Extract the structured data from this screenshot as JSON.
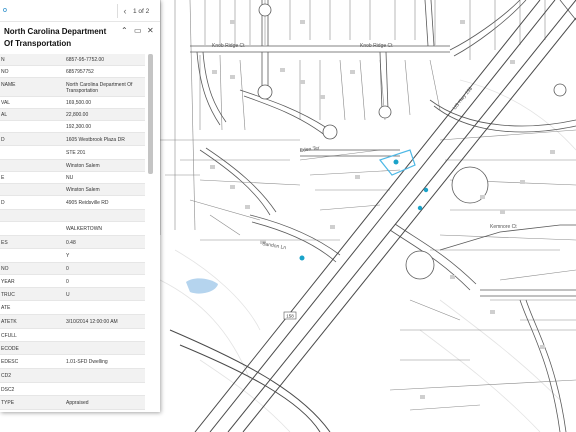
{
  "pager": {
    "zoom_label": "o",
    "count": "1 of 2"
  },
  "popup": {
    "title": "North Carolina Department Of Transportation",
    "rows": [
      {
        "key": "N",
        "value": "6857-95-7752.00"
      },
      {
        "key": "NO",
        "value": "6857957752"
      },
      {
        "key": "NAME",
        "value": "North Carolina Department Of Transportation"
      },
      {
        "key": "VAL",
        "value": "169,500.00"
      },
      {
        "key": "AL",
        "value": "22,800.00"
      },
      {
        "key": "",
        "value": "192,300.00"
      },
      {
        "key": "D",
        "value": "1605 Westbrook Plaza DR"
      },
      {
        "key": "",
        "value": "STE 201"
      },
      {
        "key": "",
        "value": "Winston Salem"
      },
      {
        "key": "E",
        "value": "NU"
      },
      {
        "key": "",
        "value": "Winston Salem"
      },
      {
        "key": "D",
        "value": "4905 Reidsville RD"
      },
      {
        "key": "",
        "value": ""
      },
      {
        "key": "",
        "value": "WALKERTOWN"
      },
      {
        "key": "ES",
        "value": "0.48"
      },
      {
        "key": "",
        "value": "Y"
      },
      {
        "key": "NO",
        "value": "0"
      },
      {
        "key": "YEAR",
        "value": "0"
      },
      {
        "key": "TRUC",
        "value": "U"
      },
      {
        "key": "ATE",
        "value": ""
      },
      {
        "key": "ATETK",
        "value": "3/10/2014 12:00:00 AM"
      },
      {
        "key": "CFULL",
        "value": ""
      },
      {
        "key": "ECODE",
        "value": ""
      },
      {
        "key": "EDESC",
        "value": "1.01-SFD Dwelling"
      },
      {
        "key": "CD2",
        "value": ""
      },
      {
        "key": "DSC2",
        "value": ""
      },
      {
        "key": "TYPE",
        "value": "Appraised"
      },
      {
        "key": "YPE",
        "value": ""
      }
    ]
  },
  "map": {
    "labels": {
      "knob_ridge_ct": "Knob Ridge Ct",
      "eden_ter": "Eden Ter",
      "sandon_ln": "Sandon Ln",
      "highway": "US Hwy 158",
      "kemnore_ct": "Kemnore Ct",
      "shield": "158"
    },
    "colors": {
      "road": "#5a5a5a",
      "parcel": "#8a8a8a",
      "water": "#b5d4ee",
      "marker": "#1aa3c9",
      "highlight": "#4db8e6"
    }
  }
}
